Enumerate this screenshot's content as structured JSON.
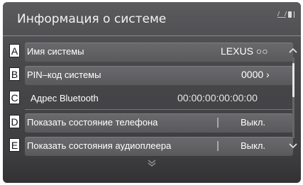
{
  "header": {
    "title": "Информация о системе"
  },
  "callouts": [
    "A",
    "B",
    "C",
    "D",
    "E"
  ],
  "rows": [
    {
      "label": "Имя системы",
      "value": "LEXUS ○○"
    },
    {
      "label": "PIN–код системы",
      "value": "0000 ›"
    },
    {
      "label": "Адрес Bluetooth",
      "value": "00:00:00:00:00:00"
    },
    {
      "label": "Показать состояние телефона",
      "value": "Выкл."
    },
    {
      "label": "Показать состояния аудиоплеера",
      "value": "Выкл."
    }
  ],
  "icons": {
    "status": [
      "signal-off-icon",
      "phone-icon",
      "bluetooth-icon"
    ],
    "scroll": [
      "chevron-up-icon",
      "chevron-down-icon"
    ],
    "more": "chevron-double-down-icon"
  },
  "colors": {
    "background": "#48484b",
    "row": "#626265",
    "text": "#ffffff"
  }
}
